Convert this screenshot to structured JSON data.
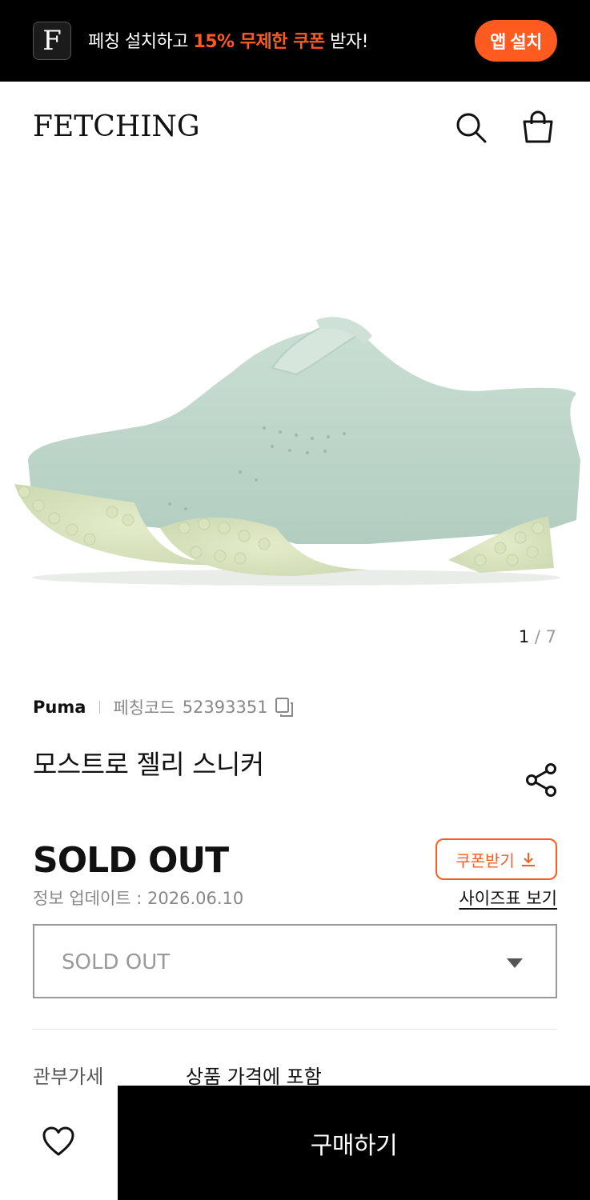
{
  "banner": {
    "app_icon_letter": "F",
    "promo_prefix": "페칭 설치하고 ",
    "promo_highlight": "15% 무제한 쿠폰",
    "promo_suffix": " 받자!",
    "install_label": "앱 설치",
    "accent_color": "#ff5a1f"
  },
  "header": {
    "logo": "FETCHING",
    "search_icon": "search-icon",
    "bag_icon": "shopping-bag-icon"
  },
  "gallery": {
    "current": "1",
    "separator": " / ",
    "total": "7"
  },
  "product": {
    "brand": "Puma",
    "code_label": "페칭코드",
    "code": "52393351",
    "title": "모스트로 젤리 스니커",
    "price": "SOLD OUT",
    "update_info": "정보 업데이트 : 2026.06.10",
    "coupon_label": "쿠폰받기",
    "size_chart_label": "사이즈표 보기",
    "option_value": "SOLD OUT",
    "duty_label": "관부가세",
    "duty_value": "상품 가격에 포함"
  },
  "footer": {
    "buy_label": "구매하기",
    "wish_icon": "heart-icon"
  }
}
